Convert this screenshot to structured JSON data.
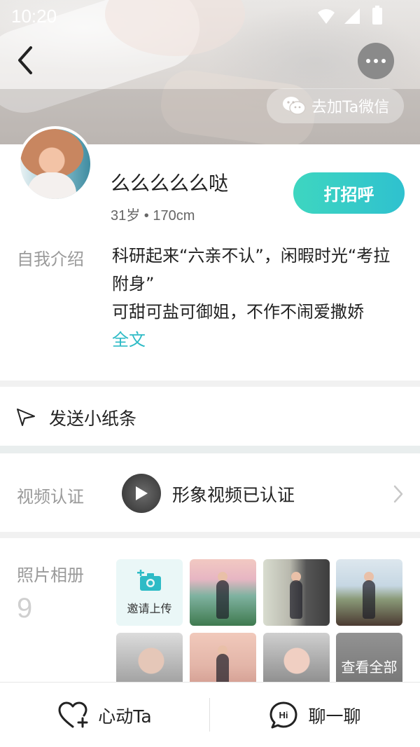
{
  "status_bar": {
    "time": "10:20"
  },
  "header": {
    "wechat_label": "去加Ta微信"
  },
  "profile": {
    "name": "么么么么么哒",
    "meta": "31岁 • 170cm",
    "greet_label": "打招呼"
  },
  "intro": {
    "label": "自我介绍",
    "line1": "科研起来“六亲不认”，闲暇时光“考拉附身”",
    "line2": "可甜可盐可御姐，不作不闹爱撒娇",
    "more_label": "全文"
  },
  "note": {
    "label": "发送小纸条"
  },
  "video": {
    "label": "视频认证",
    "status": "形象视频已认证"
  },
  "album": {
    "label": "照片相册",
    "count": "9",
    "invite_label": "邀请上传",
    "view_all_label": "查看全部"
  },
  "bottom_bar": {
    "like_label": "心动Ta",
    "chat_label": "聊一聊"
  },
  "colors": {
    "accent": "#2ebbc6",
    "greet_start": "#3ed6c0",
    "greet_end": "#2fc1cf"
  }
}
